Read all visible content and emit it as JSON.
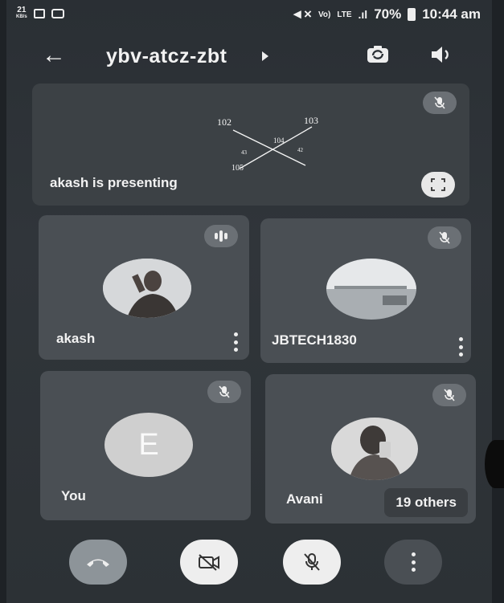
{
  "status_bar": {
    "data_speed": "21",
    "data_unit": "KB/s",
    "carrier_1": "Vo)",
    "carrier_2": "LTE",
    "battery_percent": "70%",
    "time": "10:44 am"
  },
  "app_bar": {
    "back_icon": "arrow-left-icon",
    "meeting_code": "ybv-atcz-zbt",
    "switch_camera_icon": "switch-camera-icon",
    "speaker_icon": "speaker-icon"
  },
  "presentation": {
    "label": "akash is presenting",
    "board_numbers": [
      "102",
      "103",
      "104",
      "105",
      "43",
      "42"
    ],
    "mic_state": "muted",
    "fullscreen_icon": "fullscreen-icon"
  },
  "participants": [
    {
      "name": "akash",
      "mic_state": "speaking",
      "avatar": "photo"
    },
    {
      "name": "JBTECH1830",
      "mic_state": "muted",
      "avatar": "photo"
    },
    {
      "name": "You",
      "mic_state": "muted",
      "avatar_letter": "E"
    },
    {
      "name": "Avani",
      "mic_state": "muted",
      "avatar": "photo",
      "others_label": "19 others"
    }
  ],
  "controls": [
    {
      "name": "end-call",
      "icon": "phone-hangup-icon",
      "color": "#8d9499"
    },
    {
      "name": "camera-off",
      "icon": "video-off-icon",
      "color": "#eeeeee"
    },
    {
      "name": "mic-off",
      "icon": "mic-off-icon",
      "color": "#eeeeee"
    },
    {
      "name": "more",
      "icon": "more-vertical-icon",
      "color": "#4a4f54"
    }
  ]
}
